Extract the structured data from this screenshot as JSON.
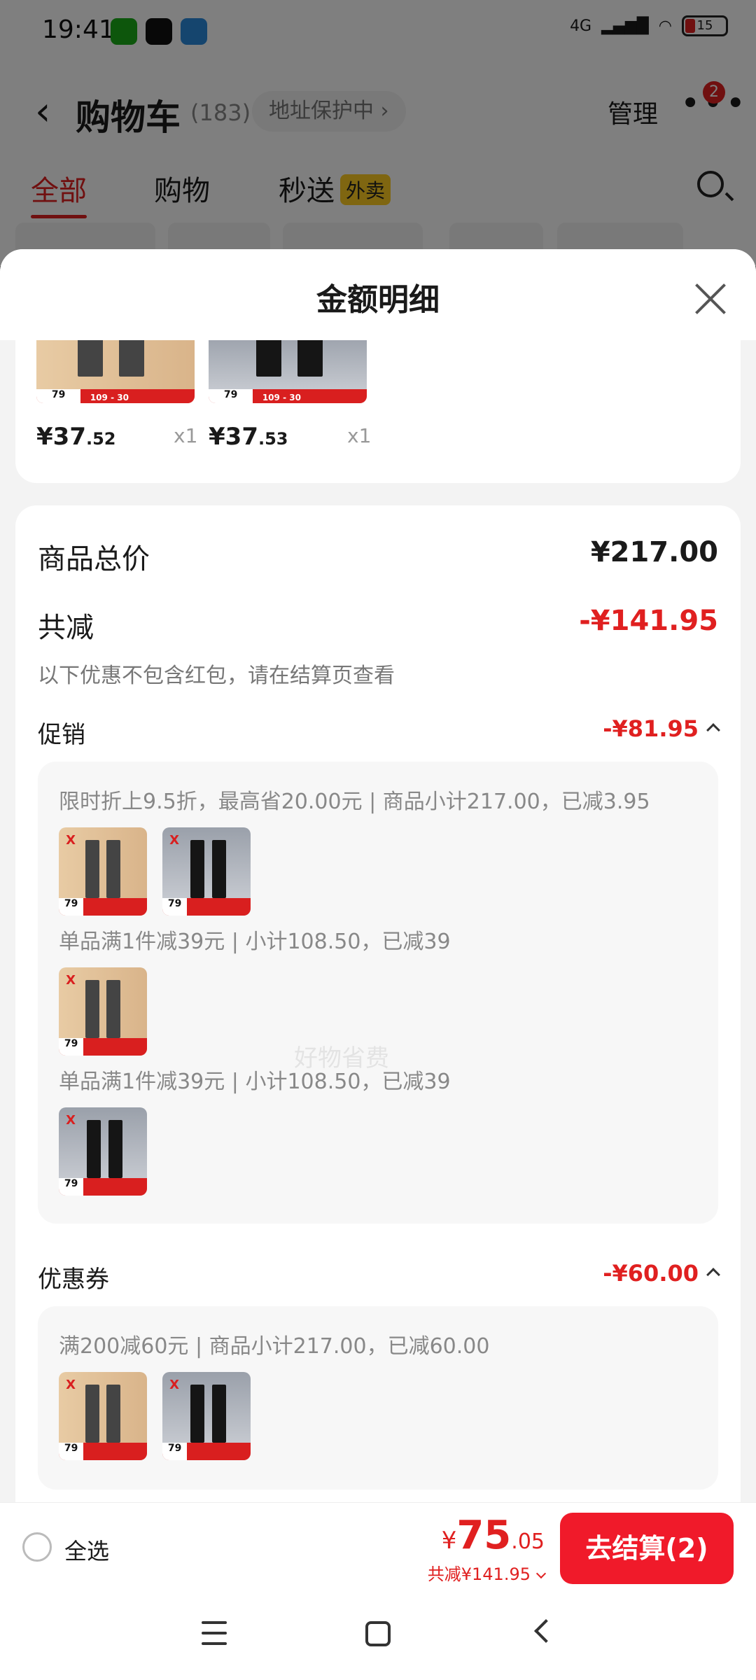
{
  "status_bar": {
    "time": "19:41",
    "network": "4G",
    "battery": "15"
  },
  "background_page": {
    "back_icon": "chevron-left-icon",
    "title": "购物车",
    "count": "(183)",
    "address_protection": "地址保护中 ›",
    "manage": "管理",
    "more_icon": "more-dots-icon",
    "more_badge": "2",
    "tabs": [
      {
        "label": "全部",
        "active": true
      },
      {
        "label": "购物",
        "active": false
      },
      {
        "label": "秒送",
        "tag": "外卖",
        "active": false
      }
    ],
    "search_icon": "search-icon"
  },
  "sheet": {
    "title": "金额明细",
    "close_icon": "close-icon",
    "products": [
      {
        "price_int": "¥37",
        "price_dec": ".52",
        "qty": "x1",
        "image_label": "79",
        "image_price": "109",
        "image_discount": "30"
      },
      {
        "price_int": "¥37",
        "price_dec": ".53",
        "qty": "x1",
        "image_label": "79",
        "image_price": "109",
        "image_discount": "30"
      }
    ],
    "totals": {
      "subtotal_label": "商品总价",
      "subtotal_value": "¥217.00",
      "reduction_label": "共减",
      "reduction_value": "-¥141.95",
      "reduction_note": "以下优惠不包含红包，请在结算页查看"
    },
    "promotion": {
      "label": "促销",
      "value": "-¥81.95",
      "lines": [
        "限时折上9.5折，最高省20.00元 | 商品小计217.00，已减3.95",
        "单品满1件减39元 | 小计108.50，已减39",
        "单品满1件减39元 | 小计108.50，已减39"
      ]
    },
    "coupon": {
      "label": "优惠券",
      "value": "-¥60.00",
      "line": "满200减60元 | 商品小计217.00，已减60.00"
    },
    "watermark": "好物省费"
  },
  "bottom_bar": {
    "select_all": "全选",
    "currency": "¥",
    "price_int": "75",
    "price_dec": ".05",
    "total_saving": "共减¥141.95",
    "checkout": "去结算(2)"
  },
  "colors": {
    "accent": "#e02020",
    "checkout": "#f01a2a"
  }
}
